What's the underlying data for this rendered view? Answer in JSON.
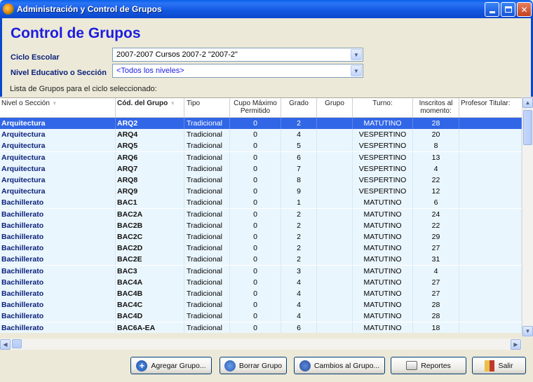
{
  "window": {
    "title": "Administración y Control de Grupos"
  },
  "page": {
    "title": "Control de Grupos",
    "ciclo_label": "Ciclo Escolar",
    "ciclo_value": "2007-2007 Cursos 2007-2 \"2007-2\"",
    "nivel_label": "Nivel Educativo o Sección",
    "nivel_value": "<Todos los niveles>",
    "list_caption": "Lista de Grupos para el ciclo seleccionado:"
  },
  "grid": {
    "headers": {
      "nivel": "Nivel o Sección",
      "cod": "Cód. del Grupo",
      "tipo": "Tipo",
      "cupo1": "Cupo Máximo",
      "cupo2": "Permitido",
      "grado": "Grado",
      "grupo": "Grupo",
      "turno": "Turno:",
      "inscritos1": "Inscritos al",
      "inscritos2": "momento:",
      "profesor": "Profesor Titular:"
    },
    "rows": [
      {
        "nivel": "Arquitectura",
        "cod": "ARQ2",
        "tipo": "Tradicional",
        "cupo": "0",
        "grado": "2",
        "grupo": "",
        "turno": "MATUTINO",
        "inscritos": "28",
        "profesor": ""
      },
      {
        "nivel": "Arquitectura",
        "cod": "ARQ4",
        "tipo": "Tradicional",
        "cupo": "0",
        "grado": "4",
        "grupo": "",
        "turno": "VESPERTINO",
        "inscritos": "20",
        "profesor": ""
      },
      {
        "nivel": "Arquitectura",
        "cod": "ARQ5",
        "tipo": "Tradicional",
        "cupo": "0",
        "grado": "5",
        "grupo": "",
        "turno": "VESPERTINO",
        "inscritos": "8",
        "profesor": ""
      },
      {
        "nivel": "Arquitectura",
        "cod": "ARQ6",
        "tipo": "Tradicional",
        "cupo": "0",
        "grado": "6",
        "grupo": "",
        "turno": "VESPERTINO",
        "inscritos": "13",
        "profesor": ""
      },
      {
        "nivel": "Arquitectura",
        "cod": "ARQ7",
        "tipo": "Tradicional",
        "cupo": "0",
        "grado": "7",
        "grupo": "",
        "turno": "VESPERTINO",
        "inscritos": "4",
        "profesor": ""
      },
      {
        "nivel": "Arquitectura",
        "cod": "ARQ8",
        "tipo": "Tradicional",
        "cupo": "0",
        "grado": "8",
        "grupo": "",
        "turno": "VESPERTINO",
        "inscritos": "22",
        "profesor": ""
      },
      {
        "nivel": "Arquitectura",
        "cod": "ARQ9",
        "tipo": "Tradicional",
        "cupo": "0",
        "grado": "9",
        "grupo": "",
        "turno": "VESPERTINO",
        "inscritos": "12",
        "profesor": ""
      },
      {
        "nivel": "Bachillerato",
        "cod": "BAC1",
        "tipo": "Tradicional",
        "cupo": "0",
        "grado": "1",
        "grupo": "",
        "turno": "MATUTINO",
        "inscritos": "6",
        "profesor": ""
      },
      {
        "nivel": "Bachillerato",
        "cod": "BAC2A",
        "tipo": "Tradicional",
        "cupo": "0",
        "grado": "2",
        "grupo": "",
        "turno": "MATUTINO",
        "inscritos": "24",
        "profesor": ""
      },
      {
        "nivel": "Bachillerato",
        "cod": "BAC2B",
        "tipo": "Tradicional",
        "cupo": "0",
        "grado": "2",
        "grupo": "",
        "turno": "MATUTINO",
        "inscritos": "22",
        "profesor": ""
      },
      {
        "nivel": "Bachillerato",
        "cod": "BAC2C",
        "tipo": "Tradicional",
        "cupo": "0",
        "grado": "2",
        "grupo": "",
        "turno": "MATUTINO",
        "inscritos": "29",
        "profesor": ""
      },
      {
        "nivel": "Bachillerato",
        "cod": "BAC2D",
        "tipo": "Tradicional",
        "cupo": "0",
        "grado": "2",
        "grupo": "",
        "turno": "MATUTINO",
        "inscritos": "27",
        "profesor": ""
      },
      {
        "nivel": "Bachillerato",
        "cod": "BAC2E",
        "tipo": "Tradicional",
        "cupo": "0",
        "grado": "2",
        "grupo": "",
        "turno": "MATUTINO",
        "inscritos": "31",
        "profesor": ""
      },
      {
        "nivel": "Bachillerato",
        "cod": "BAC3",
        "tipo": "Tradicional",
        "cupo": "0",
        "grado": "3",
        "grupo": "",
        "turno": "MATUTINO",
        "inscritos": "4",
        "profesor": ""
      },
      {
        "nivel": "Bachillerato",
        "cod": "BAC4A",
        "tipo": "Tradicional",
        "cupo": "0",
        "grado": "4",
        "grupo": "",
        "turno": "MATUTINO",
        "inscritos": "27",
        "profesor": ""
      },
      {
        "nivel": "Bachillerato",
        "cod": "BAC4B",
        "tipo": "Tradicional",
        "cupo": "0",
        "grado": "4",
        "grupo": "",
        "turno": "MATUTINO",
        "inscritos": "27",
        "profesor": ""
      },
      {
        "nivel": "Bachillerato",
        "cod": "BAC4C",
        "tipo": "Tradicional",
        "cupo": "0",
        "grado": "4",
        "grupo": "",
        "turno": "MATUTINO",
        "inscritos": "28",
        "profesor": ""
      },
      {
        "nivel": "Bachillerato",
        "cod": "BAC4D",
        "tipo": "Tradicional",
        "cupo": "0",
        "grado": "4",
        "grupo": "",
        "turno": "MATUTINO",
        "inscritos": "28",
        "profesor": ""
      },
      {
        "nivel": "Bachillerato",
        "cod": "BAC6A-EA",
        "tipo": "Tradicional",
        "cupo": "0",
        "grado": "6",
        "grupo": "",
        "turno": "MATUTINO",
        "inscritos": "18",
        "profesor": ""
      }
    ],
    "selected_row": 0
  },
  "buttons": {
    "agregar": "Agregar Grupo...",
    "borrar": "Borrar Grupo",
    "cambios": "Cambios al Grupo...",
    "reportes": "Reportes",
    "salir": "Salir"
  },
  "colors": {
    "accent": "#1c1ce0",
    "selection": "#3166e6",
    "row_bg": "#eaf6fd"
  }
}
